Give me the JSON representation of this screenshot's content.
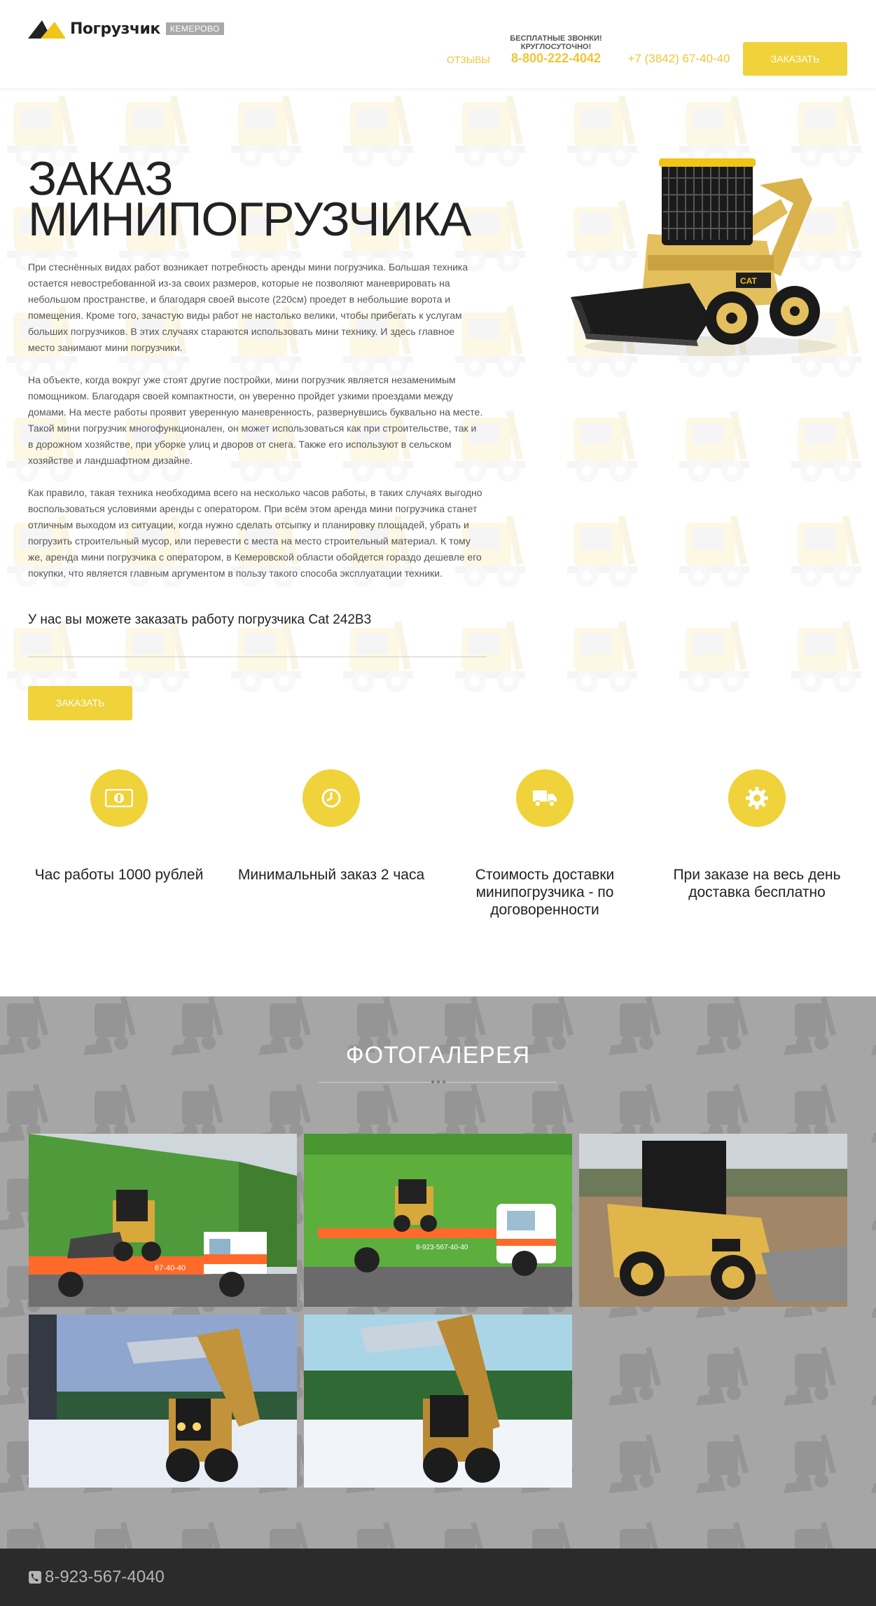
{
  "header": {
    "logo_text": "Погрузчик",
    "city_badge": "КЕМЕРОВО",
    "reviews_link": "ОТЗЫВЫ",
    "free_calls_line1": "БЕСПЛАТНЫЕ ЗВОНКИ!",
    "free_calls_line2": "КРУГЛОСУТОЧНО!",
    "free_phone": "8-800-222-4042",
    "city_phone": "+7 (3842) 67-40-40",
    "order_button": "ЗАКАЗАТЬ"
  },
  "hero": {
    "title_line1": "ЗАКАЗ",
    "title_line2": "МИНИПОГРУЗЧИКА",
    "paragraphs": [
      "При стеснённых видах работ возникает потребность аренды мини погрузчика. Большая техника остается невостребованной из-за своих размеров, которые не позволяют маневрировать на небольшом пространстве, и благодаря своей высоте (220см) проедет в небольшие ворота и помещения. Кроме того, зачастую виды работ не настолько велики, чтобы прибегать к услугам больших погрузчиков. В этих случаях стараются использовать мини технику. И здесь главное место занимают мини погрузчики.",
      "На объекте, когда вокруг уже стоят другие постройки, мини погрузчик является незаменимым помощником. Благодаря своей компактности, он уверенно пройдет узкими проездами между домами. На месте работы проявит уверенную маневренность, развернувшись буквально на месте. Такой мини погрузчик многофункционален, он может использоваться как при строительстве, так и в дорожном хозяйстве, при уборке улиц и дворов от снега. Также его используют в сельском хозяйстве и ландшафтном дизайне.",
      "Как правило, такая техника необходима всего на несколько часов работы, в таких случаях выгодно воспользоваться условиями аренды с оператором. При всём этом аренда мини погрузчика станет отличным выходом из ситуации, когда нужно сделать отсыпку и планировку площадей, убрать и погрузить строительный мусор, или перевести с места на место строительный материал. К тому же, аренда мини погрузчика с оператором, в Кемеровской области обойдется гораздо дешевле его покупки, что является главным аргументом в пользу такого способа эксплуатации техники."
    ],
    "subheading": "У нас вы можете заказать работу погрузчика Cat 242B3",
    "order_button": "ЗАКАЗАТЬ"
  },
  "features": [
    {
      "icon": "money-icon",
      "label": "Час работы 1000 рублей"
    },
    {
      "icon": "clock-icon",
      "label": "Минимальный заказ 2 часа"
    },
    {
      "icon": "truck-icon",
      "label": "Стоимость доставки минипогрузчика - по договоренности"
    },
    {
      "icon": "gear-icon",
      "label": "При заказе на весь день доставка бесплатно"
    }
  ],
  "gallery": {
    "title": "ФОТОГАЛЕРЕЯ",
    "photos": [
      {
        "name": "photo-loader-on-tow-truck-1",
        "truck_sign": "67-40-40"
      },
      {
        "name": "photo-loader-on-tow-truck-2",
        "truck_sign": "8-923-567-40-40"
      },
      {
        "name": "photo-cat-242b3-field",
        "truck_sign": ""
      },
      {
        "name": "photo-loader-snow-night",
        "truck_sign": ""
      },
      {
        "name": "photo-loader-snow-day",
        "truck_sign": ""
      }
    ]
  },
  "footer": {
    "phone": "8-923-567-4040"
  },
  "colors": {
    "accent": "#f0d23a",
    "accent_text": "#efc638",
    "gallery_bg": "#a6a6a6",
    "footer_bg": "#2b2b2b"
  }
}
